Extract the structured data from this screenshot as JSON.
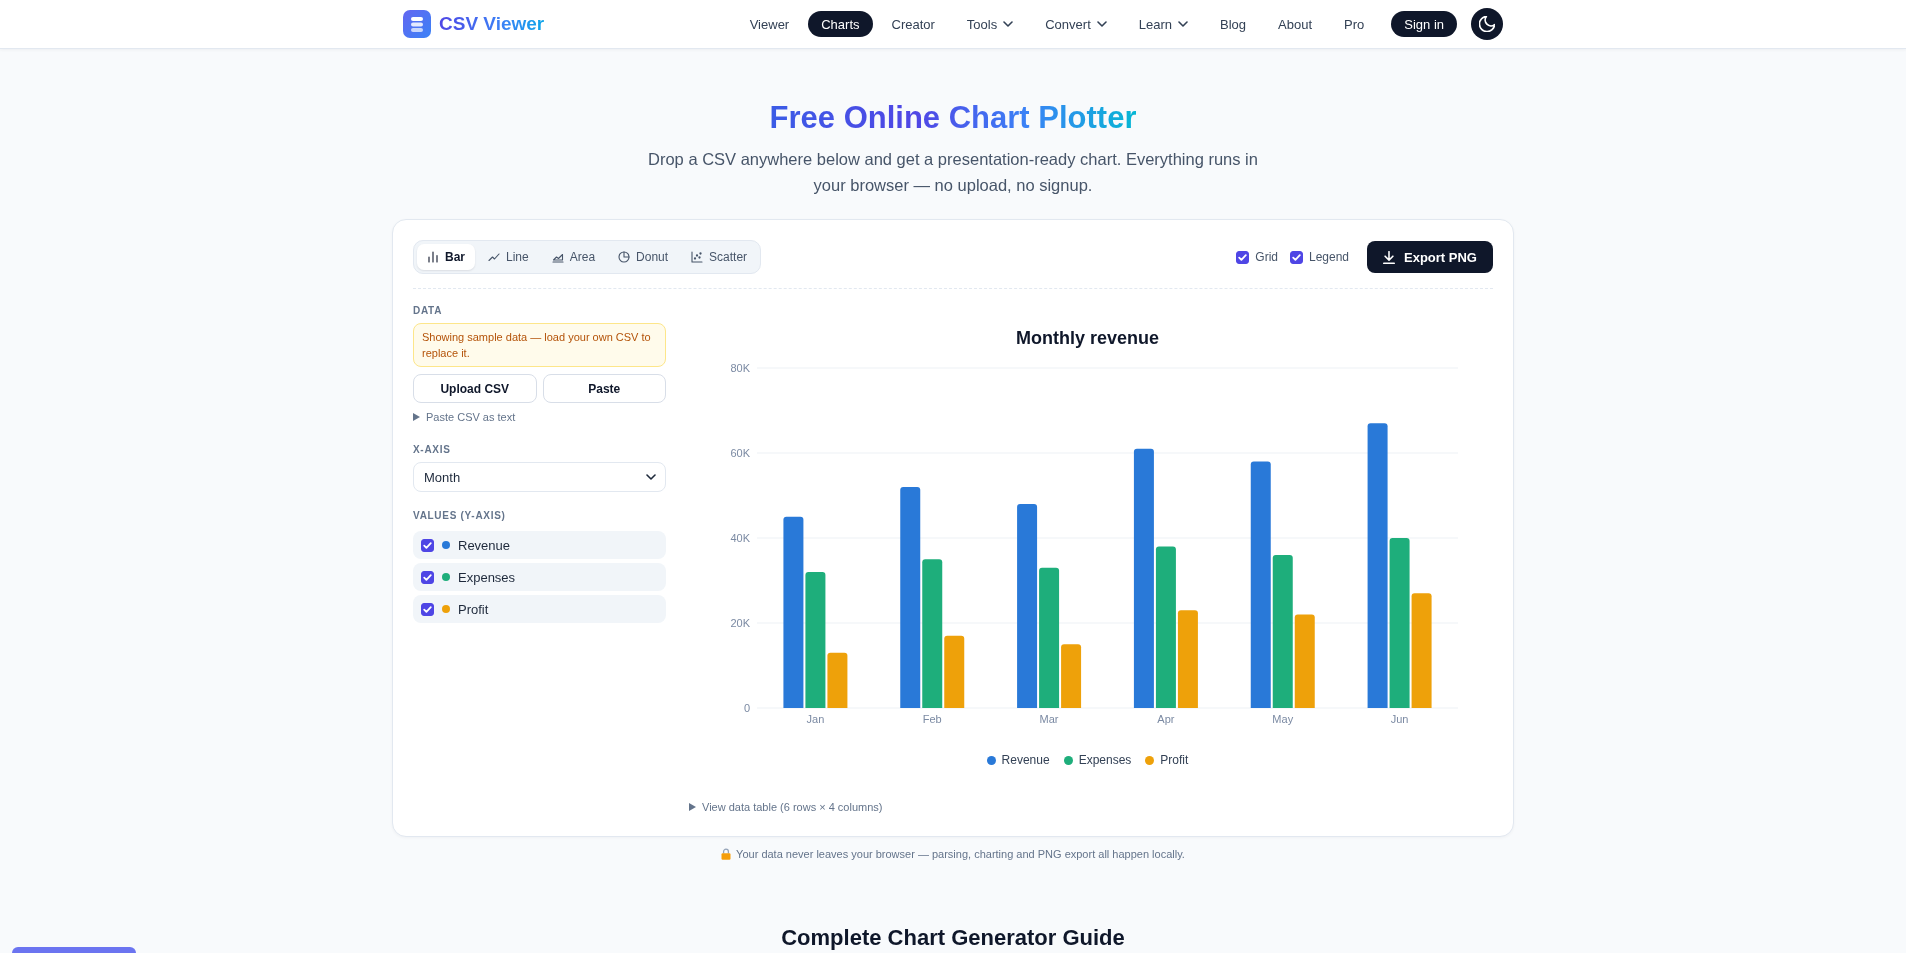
{
  "header": {
    "logo_text": "CSV Viewer",
    "nav": [
      {
        "label": "Viewer",
        "selected": false,
        "dropdown": false
      },
      {
        "label": "Charts",
        "selected": true,
        "dropdown": false
      },
      {
        "label": "Creator",
        "selected": false,
        "dropdown": false
      },
      {
        "label": "Tools",
        "selected": false,
        "dropdown": true
      },
      {
        "label": "Convert",
        "selected": false,
        "dropdown": true
      },
      {
        "label": "Learn",
        "selected": false,
        "dropdown": true
      },
      {
        "label": "Blog",
        "selected": false,
        "dropdown": false
      },
      {
        "label": "About",
        "selected": false,
        "dropdown": false
      },
      {
        "label": "Pro",
        "selected": false,
        "dropdown": false
      }
    ],
    "sign_in_button": "Sign in"
  },
  "hero": {
    "title": "Free Online Chart Plotter",
    "subtitle": "Drop a CSV anywhere below and get a presentation-ready chart. Everything runs in your browser — no upload, no signup."
  },
  "toolbar": {
    "chart_types": [
      {
        "label": "Bar",
        "kind": "bar",
        "selected": true
      },
      {
        "label": "Line",
        "kind": "line",
        "selected": false
      },
      {
        "label": "Area",
        "kind": "area",
        "selected": false
      },
      {
        "label": "Donut",
        "kind": "donut",
        "selected": false
      },
      {
        "label": "Scatter",
        "kind": "scatter",
        "selected": false
      }
    ],
    "toggles": [
      {
        "label": "Grid",
        "checked": true
      },
      {
        "label": "Legend",
        "checked": true
      }
    ],
    "export_button": "Export PNG"
  },
  "data_panel": {
    "data_heading": "DATA",
    "notice": "Showing sample data — load your own CSV to replace it.",
    "buttons": [
      "Upload CSV",
      "Paste"
    ],
    "paste_toggle": "Paste CSV as text",
    "x_axis_heading": "X-AXIS",
    "x_axis_select": "Month",
    "values_heading": "VALUES (Y-AXIS)",
    "series": [
      {
        "name": "Revenue",
        "checked": true,
        "color": "#2979d8"
      },
      {
        "name": "Expenses",
        "checked": true,
        "color": "#1eae7b"
      },
      {
        "name": "Profit",
        "checked": true,
        "color": "#eea10a"
      }
    ]
  },
  "chart": {
    "chart_data": {
      "type": "bar",
      "title": "Monthly revenue",
      "categories": [
        "Jan",
        "Feb",
        "Mar",
        "Apr",
        "May",
        "Jun"
      ],
      "series": [
        {
          "name": "Revenue",
          "color": "#2979d8",
          "values": [
            45000,
            52000,
            48000,
            61000,
            58000,
            67000
          ]
        },
        {
          "name": "Expenses",
          "color": "#1eae7b",
          "values": [
            32000,
            35000,
            33000,
            38000,
            36000,
            40000
          ]
        },
        {
          "name": "Profit",
          "color": "#eea10a",
          "values": [
            13000,
            17000,
            15000,
            23000,
            22000,
            27000
          ]
        }
      ],
      "ylim": [
        0,
        80000
      ],
      "yticks": [
        {
          "value": 0,
          "label": "0"
        },
        {
          "value": 20000,
          "label": "20K"
        },
        {
          "value": 40000,
          "label": "40K"
        },
        {
          "value": 60000,
          "label": "60K"
        },
        {
          "value": 80000,
          "label": "80K"
        }
      ],
      "grid": true,
      "legend": "bottom"
    },
    "data_table_toggle": "View data table (6 rows × 4 columns)"
  },
  "privacy_note": "Your data never leaves your browser — parsing, charting and PNG export all happen locally.",
  "guide_heading": "Complete Chart Generator Guide"
}
